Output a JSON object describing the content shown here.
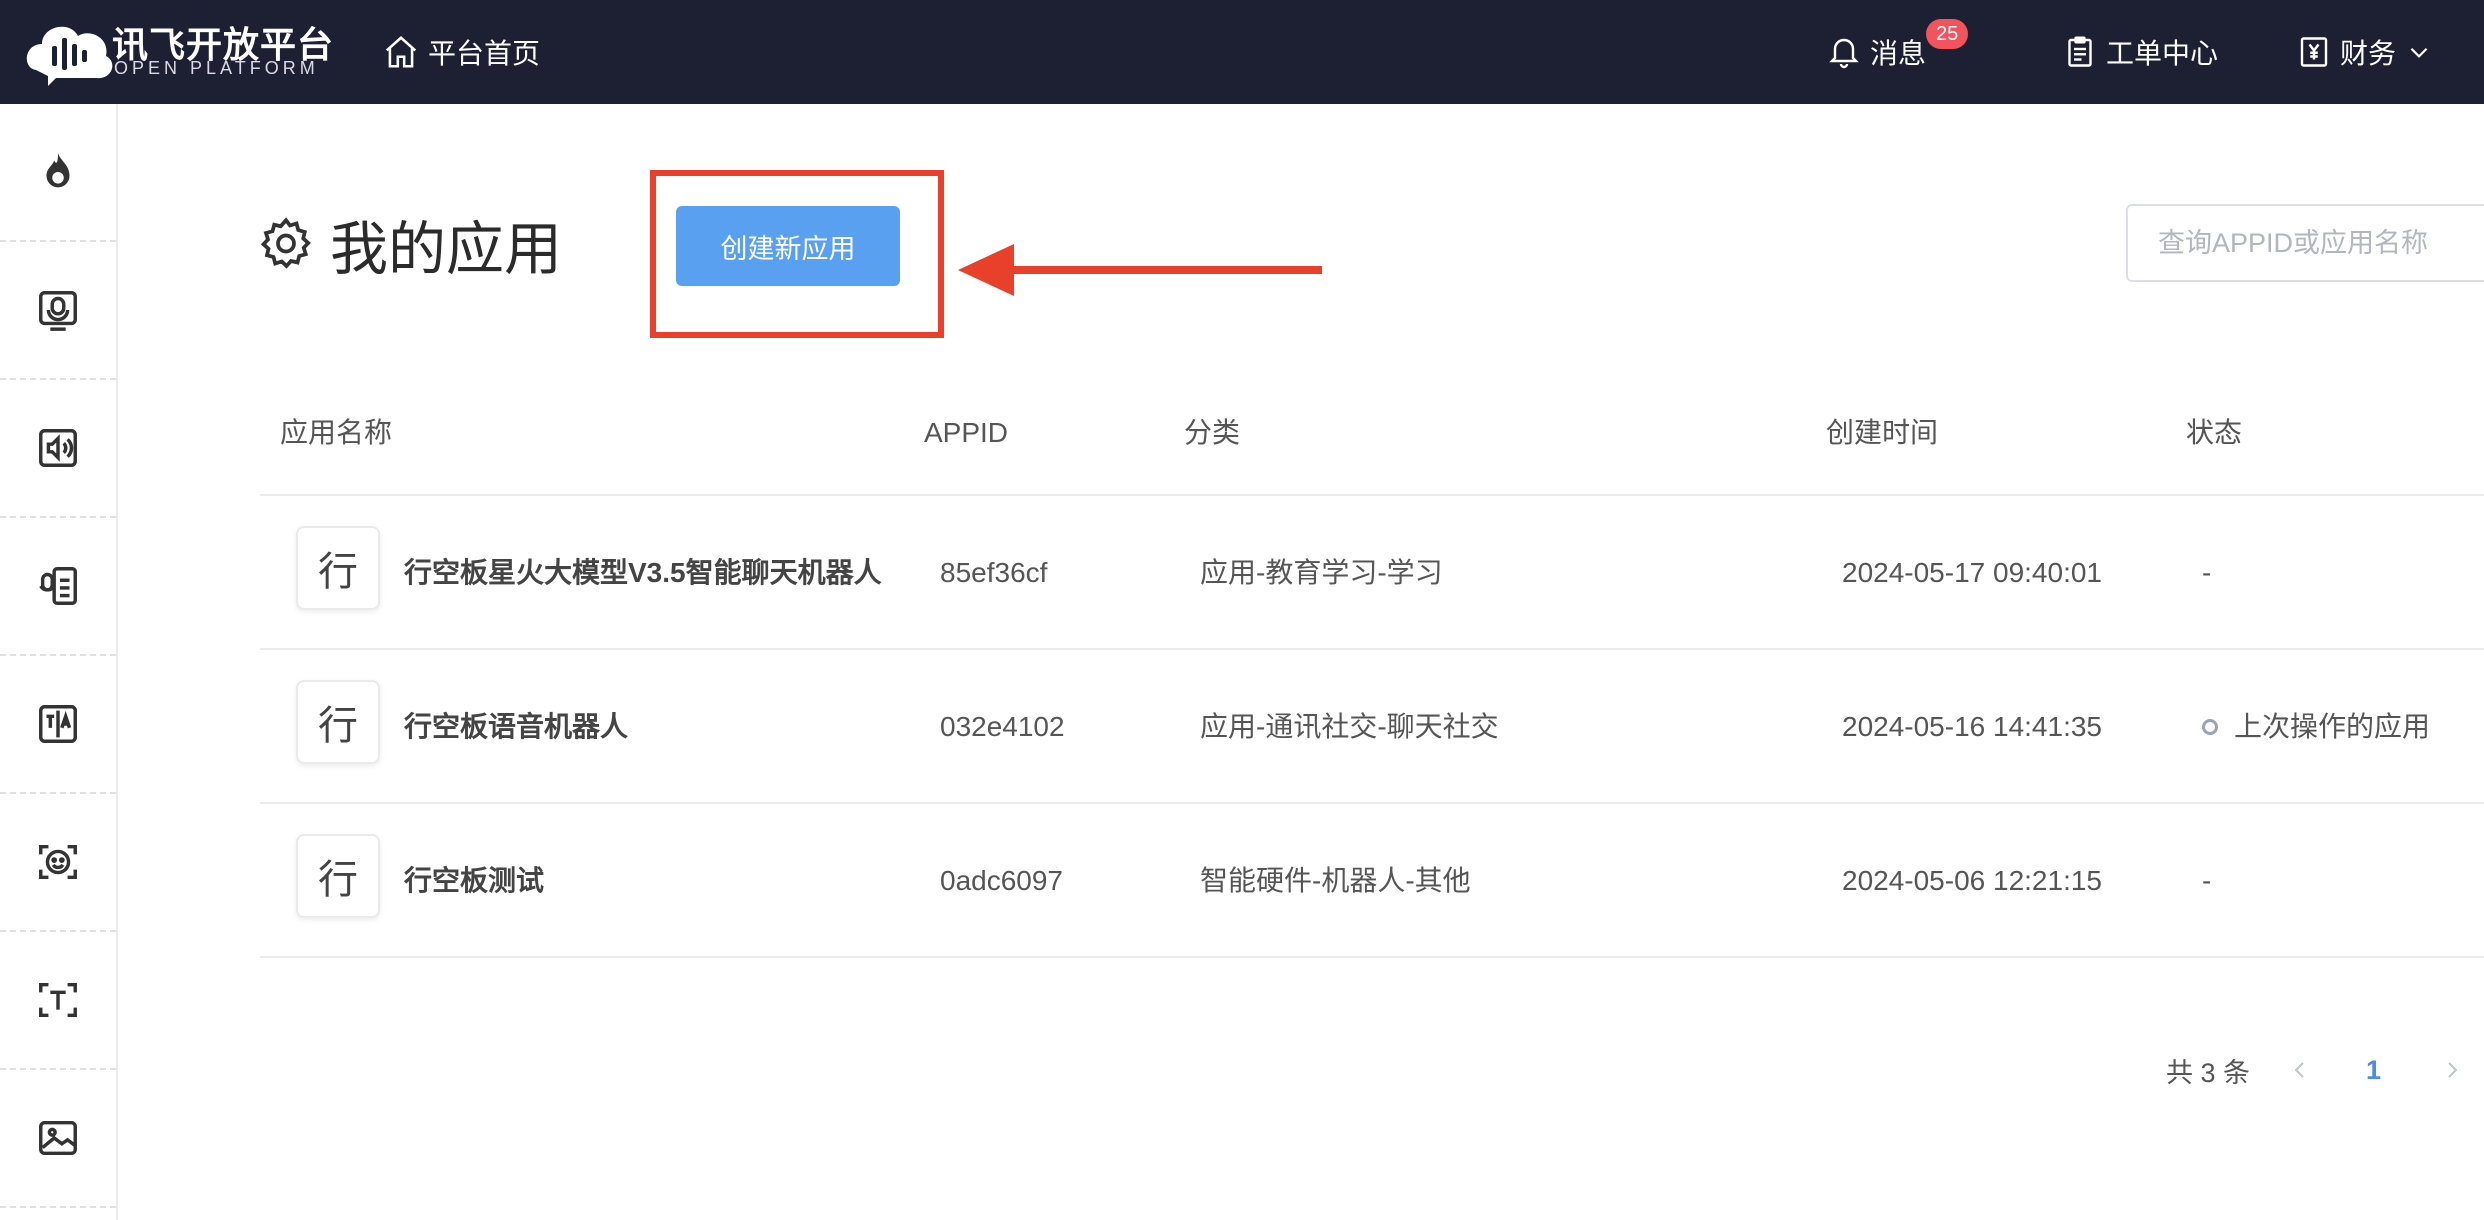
{
  "brand": {
    "name": "讯飞开放平台",
    "sub": "OPEN PLATFORM"
  },
  "header": {
    "home": "平台首页",
    "messages": "消息",
    "message_count": "25",
    "tickets": "工单中心",
    "finance": "财务"
  },
  "sidebar": {
    "items": [
      "flame-icon",
      "voice-recognition-icon",
      "speech-synthesis-icon",
      "voice-document-icon",
      "translation-icon",
      "face-recognition-icon",
      "text-recognition-icon",
      "image-recognition-icon"
    ]
  },
  "page": {
    "title": "我的应用",
    "create_button": "创建新应用",
    "search_placeholder": "查询APPID或应用名称"
  },
  "table": {
    "columns": [
      "应用名称",
      "APPID",
      "分类",
      "创建时间",
      "状态"
    ],
    "rows": [
      {
        "icon": "行",
        "name": "行空板星火大模型V3.5智能聊天机器人",
        "appid": "85ef36cf",
        "category": "应用-教育学习-学习",
        "created": "2024-05-17 09:40:01",
        "status": "-"
      },
      {
        "icon": "行",
        "name": "行空板语音机器人",
        "appid": "032e4102",
        "category": "应用-通讯社交-聊天社交",
        "created": "2024-05-16 14:41:35",
        "status": "上次操作的应用"
      },
      {
        "icon": "行",
        "name": "行空板测试",
        "appid": "0adc6097",
        "category": "智能硬件-机器人-其他",
        "created": "2024-05-06 12:21:15",
        "status": "-"
      }
    ]
  },
  "pagination": {
    "total": "共 3 条",
    "current": "1"
  },
  "colors": {
    "topbar": "#1d2033",
    "primary": "#5aa0f0",
    "highlight": "#e8402a",
    "badge": "#f2535d"
  }
}
